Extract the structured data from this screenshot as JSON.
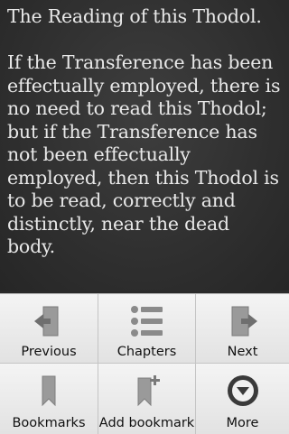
{
  "reader": {
    "title": "The Reading of this Thodol.",
    "body": "If the Transference has been effectually employed, there is no need to read this Thodol; but if the Transference has not been effectually employed, then this Thodol is to be read, correctly and distinctly, near the dead body."
  },
  "menu": {
    "items": [
      {
        "label": "Previous",
        "icon": "previous-icon"
      },
      {
        "label": "Chapters",
        "icon": "chapters-icon"
      },
      {
        "label": "Next",
        "icon": "next-icon"
      },
      {
        "label": "Bookmarks",
        "icon": "bookmarks-icon"
      },
      {
        "label": "Add bookmark",
        "icon": "add-bookmark-icon"
      },
      {
        "label": "More",
        "icon": "more-icon"
      }
    ],
    "icon_color": "#8d8d8d"
  }
}
